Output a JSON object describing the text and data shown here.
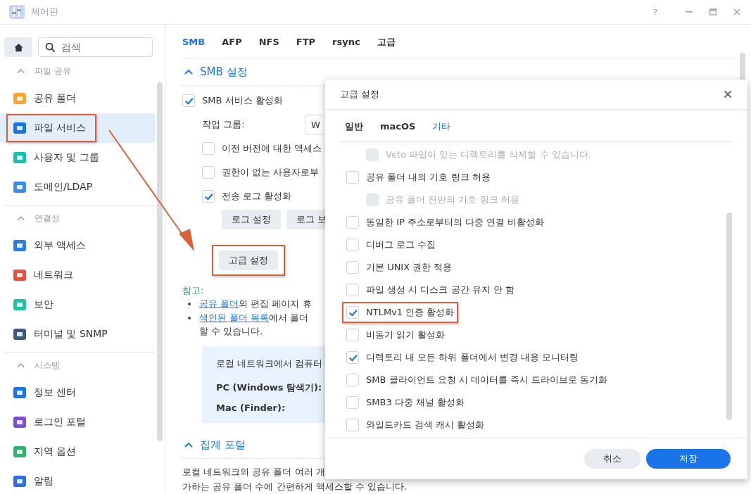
{
  "window": {
    "title": "제어판",
    "help": "?"
  },
  "sidebar": {
    "search": {
      "placeholder": "검색"
    },
    "groups": [
      {
        "title": "파일 공유",
        "expanded": true,
        "items": [
          {
            "label": "공유 폴더",
            "selected": false,
            "highlighted": false
          },
          {
            "label": "파일 서비스",
            "selected": true,
            "highlighted": true
          },
          {
            "label": "사용자 및 그룹",
            "selected": false,
            "highlighted": false
          },
          {
            "label": "도메인/LDAP",
            "selected": false,
            "highlighted": false
          }
        ]
      },
      {
        "title": "연결성",
        "expanded": true,
        "items": [
          {
            "label": "외부 액세스",
            "selected": false,
            "highlighted": false
          },
          {
            "label": "네트워크",
            "selected": false,
            "highlighted": false
          },
          {
            "label": "보안",
            "selected": false,
            "highlighted": false
          },
          {
            "label": "터미널 및 SNMP",
            "selected": false,
            "highlighted": false
          }
        ]
      },
      {
        "title": "시스템",
        "expanded": true,
        "items": [
          {
            "label": "정보 센터",
            "selected": false,
            "highlighted": false
          },
          {
            "label": "로그인 포털",
            "selected": false,
            "highlighted": false
          },
          {
            "label": "지역 옵션",
            "selected": false,
            "highlighted": false
          },
          {
            "label": "알림",
            "selected": false,
            "highlighted": false
          }
        ]
      }
    ]
  },
  "tabs": [
    {
      "label": "SMB",
      "selected": true
    },
    {
      "label": "AFP",
      "selected": false
    },
    {
      "label": "NFS",
      "selected": false
    },
    {
      "label": "FTP",
      "selected": false
    },
    {
      "label": "rsync",
      "selected": false
    },
    {
      "label": "고급",
      "selected": false
    }
  ],
  "smb": {
    "title": "SMB 설정",
    "expanded": true,
    "enable": {
      "label": "SMB 서비스 활성화",
      "checked": true
    },
    "workgroup": {
      "label": "작업 그룹:",
      "value": "W"
    },
    "options": [
      {
        "label": "이전 버전에 대한 액세스",
        "checked": false
      },
      {
        "label": "권한이 없는 사용자로부",
        "checked": false
      },
      {
        "label": "전송 로그 활성화",
        "checked": true
      }
    ],
    "log_buttons": [
      "로그 설정",
      "로그 보"
    ],
    "advanced_button": {
      "label": "고급 설정",
      "highlighted": true
    },
    "note": {
      "title": "참고:",
      "items": [
        {
          "link": "공유 폴더",
          "text": "의 편집 페이지 휴"
        },
        {
          "link": "색인된 폴더 목록",
          "text": "에서 폴더",
          "continuation": "할 수 있습니다."
        }
      ]
    },
    "info_box": {
      "text": "로컬 네트워크에서 컴퓨터",
      "rows": [
        "PC (Windows 탐색기):",
        "Mac (Finder):"
      ]
    }
  },
  "portal": {
    "title": "집계 포털",
    "expanded": true,
    "lines": [
      "로컬 네트워크의 공유 폴더 여러 개",
      "가하는 공유 폴더 수에 간편하게 액세스할 수 있습니다."
    ]
  },
  "dialog": {
    "title": "고급 설정",
    "tabs": [
      {
        "label": "일반",
        "selected": false
      },
      {
        "label": "macOS",
        "selected": false
      },
      {
        "label": "기타",
        "selected": true
      }
    ],
    "options": [
      {
        "kind": "sub",
        "label": "Veto 파일이 있는 디렉토리를 삭제할 수 있습니다.",
        "checked": false,
        "disabled": true,
        "highlighted": false
      },
      {
        "kind": "option",
        "label": "공유 폴더 내의 기호 링크 허용",
        "checked": false,
        "disabled": false,
        "highlighted": false,
        "children": [
          {
            "kind": "sub",
            "label": "공유 폴더 전반의 기호 링크 허용",
            "checked": false,
            "disabled": true,
            "highlighted": false
          }
        ]
      },
      {
        "kind": "option",
        "label": "동일한 IP 주소로부터의 다중 연결 비활성화",
        "checked": false,
        "disabled": false,
        "highlighted": false
      },
      {
        "kind": "option",
        "label": "디버그 로그 수집",
        "checked": false,
        "disabled": false,
        "highlighted": false
      },
      {
        "kind": "option",
        "label": "기본 UNIX 권한 적용",
        "checked": false,
        "disabled": false,
        "highlighted": false
      },
      {
        "kind": "option",
        "label": "파일 생성 시 디스크 공간 유지 안 함",
        "checked": false,
        "disabled": false,
        "highlighted": false
      },
      {
        "kind": "option",
        "label": "NTLMv1 인증 활성화",
        "checked": true,
        "disabled": false,
        "highlighted": true
      },
      {
        "kind": "option",
        "label": "비동기 읽기 활성화",
        "checked": false,
        "disabled": false,
        "highlighted": false
      },
      {
        "kind": "option",
        "label": "디렉토리 내 모든 하위 폴더에서 변경 내용 모니터링",
        "checked": true,
        "disabled": false,
        "highlighted": false
      },
      {
        "kind": "option",
        "label": "SMB 클라이언트 요청 시 데이터를 즉시 드라이브로 동기화",
        "checked": false,
        "disabled": false,
        "highlighted": false
      },
      {
        "kind": "option",
        "label": "SMB3 다중 채널 활성화",
        "checked": false,
        "disabled": false,
        "highlighted": false
      },
      {
        "kind": "option",
        "label": "와일드카드 검색 캐시 활성화",
        "checked": false,
        "disabled": false,
        "highlighted": false
      }
    ],
    "buttons": [
      {
        "label": "취소",
        "kind": "secondary"
      },
      {
        "label": "저장",
        "kind": "primary"
      }
    ]
  }
}
